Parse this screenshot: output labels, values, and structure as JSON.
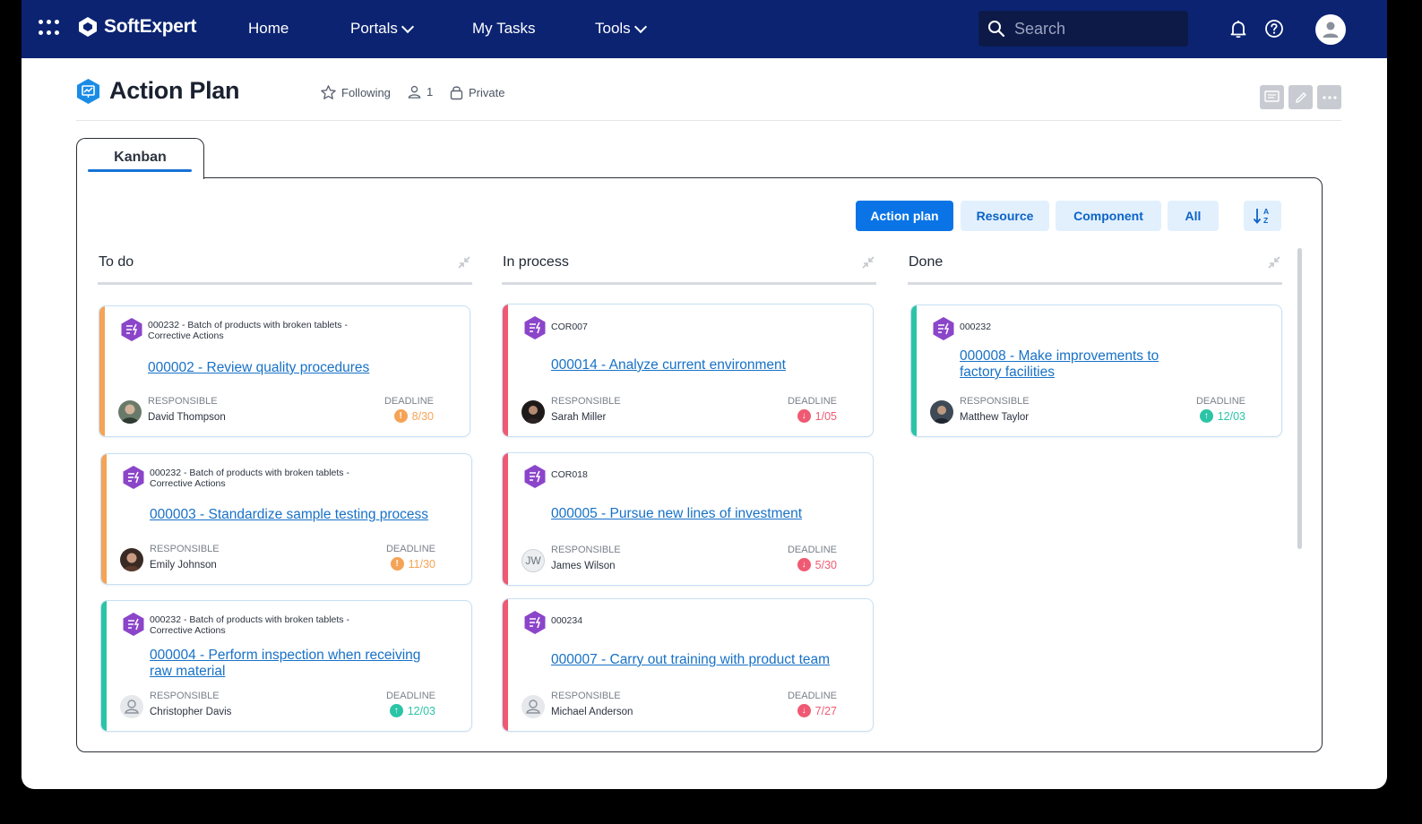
{
  "topbar": {
    "brand": "SoftExpert",
    "nav": {
      "home": "Home",
      "portals": "Portals",
      "my_tasks": "My Tasks",
      "tools": "Tools"
    },
    "search_placeholder": "Search"
  },
  "page": {
    "title": "Action Plan",
    "following": "Following",
    "members": "1",
    "privacy": "Private"
  },
  "tab": {
    "label": "Kanban"
  },
  "filters": {
    "action_plan": "Action plan",
    "resource": "Resource",
    "component": "Component",
    "all": "All"
  },
  "labels": {
    "responsible": "RESPONSIBLE",
    "deadline": "DEADLINE"
  },
  "colors": {
    "orange": "#f5a356",
    "red": "#ef5a72",
    "teal": "#2cc4a7",
    "accent": "#0a74e6",
    "navy": "#0b2371",
    "purple": "#8b45c9"
  },
  "columns": {
    "todo": {
      "title": "To do",
      "cards": [
        {
          "ref": "000232 - Batch of products with broken tablets - Corrective Actions",
          "title": "000002 - Review quality procedures",
          "responsible": "David Thompson",
          "deadline": "8/30"
        },
        {
          "ref": "000232 - Batch of products with broken tablets - Corrective Actions",
          "title": "000003 - Standardize sample testing process",
          "responsible": "Emily Johnson",
          "deadline": "11/30"
        },
        {
          "ref": "000232 - Batch of products with broken tablets - Corrective Actions",
          "title": "000004 - Perform inspection when receiving raw material",
          "responsible": "Christopher Davis",
          "deadline": "12/03"
        }
      ]
    },
    "inprocess": {
      "title": "In process",
      "cards": [
        {
          "ref": "COR007",
          "title": "000014 - Analyze current environment",
          "responsible": "Sarah Miller",
          "deadline": "1/05"
        },
        {
          "ref": "COR018",
          "title": "000005 - Pursue new lines of investment",
          "responsible": "James Wilson",
          "initials": "JW",
          "deadline": "5/30"
        },
        {
          "ref": "000234",
          "title": "000007 - Carry out training with product team",
          "responsible": "Michael Anderson",
          "deadline": "7/27"
        }
      ]
    },
    "done": {
      "title": "Done",
      "cards": [
        {
          "ref": "000232",
          "title": "000008 - Make improvements to factory facilities",
          "responsible": "Matthew Taylor",
          "deadline": "12/03"
        }
      ]
    }
  }
}
